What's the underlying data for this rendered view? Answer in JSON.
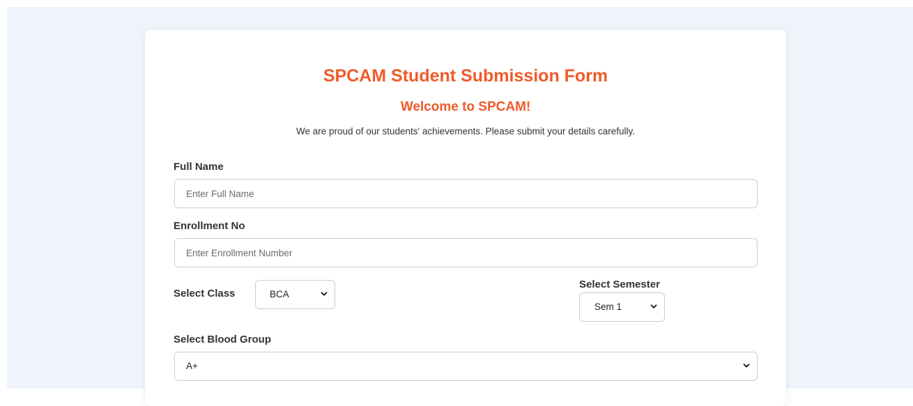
{
  "form": {
    "title": "SPCAM Student Submission Form",
    "welcome": "Welcome to SPCAM!",
    "intro": "We are proud of our students' achievements. Please submit your details carefully.",
    "full_name": {
      "label": "Full Name",
      "placeholder": "Enter Full Name",
      "value": ""
    },
    "enrollment": {
      "label": "Enrollment No",
      "placeholder": "Enter Enrollment Number",
      "value": ""
    },
    "class_select": {
      "label": "Select Class",
      "selected": "BCA"
    },
    "semester_select": {
      "label": "Select Semester",
      "selected": "Sem 1"
    },
    "blood_group": {
      "label": "Select Blood Group",
      "selected": "A+"
    }
  },
  "colors": {
    "accent": "#f05a28",
    "page_background": "#eff3fa",
    "card_background": "#ffffff",
    "text": "#333333",
    "border": "#cccccc"
  },
  "icons": {
    "dropdown": "chevron-down-icon"
  }
}
